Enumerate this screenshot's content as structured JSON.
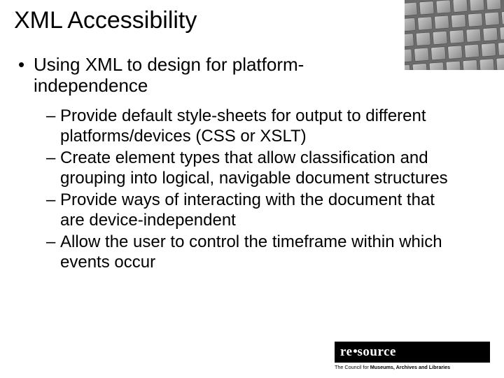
{
  "title": "XML Accessibility",
  "bullet": {
    "mark": "•",
    "text": "Using XML to design for platform-independence"
  },
  "sub": {
    "mark": "–",
    "items": [
      "Provide default style-sheets for output to different platforms/devices (CSS or XSLT)",
      "Create element types that allow classification and grouping into logical, navigable document structures",
      "Provide ways of interacting with the document that are device-independent",
      "Allow the user to control the timeframe within which events occur"
    ]
  },
  "logo": {
    "top_left": "re",
    "top_right": "source",
    "sub_prefix": "The Council for ",
    "sub_bold": "Museums, Archives and Libraries"
  }
}
